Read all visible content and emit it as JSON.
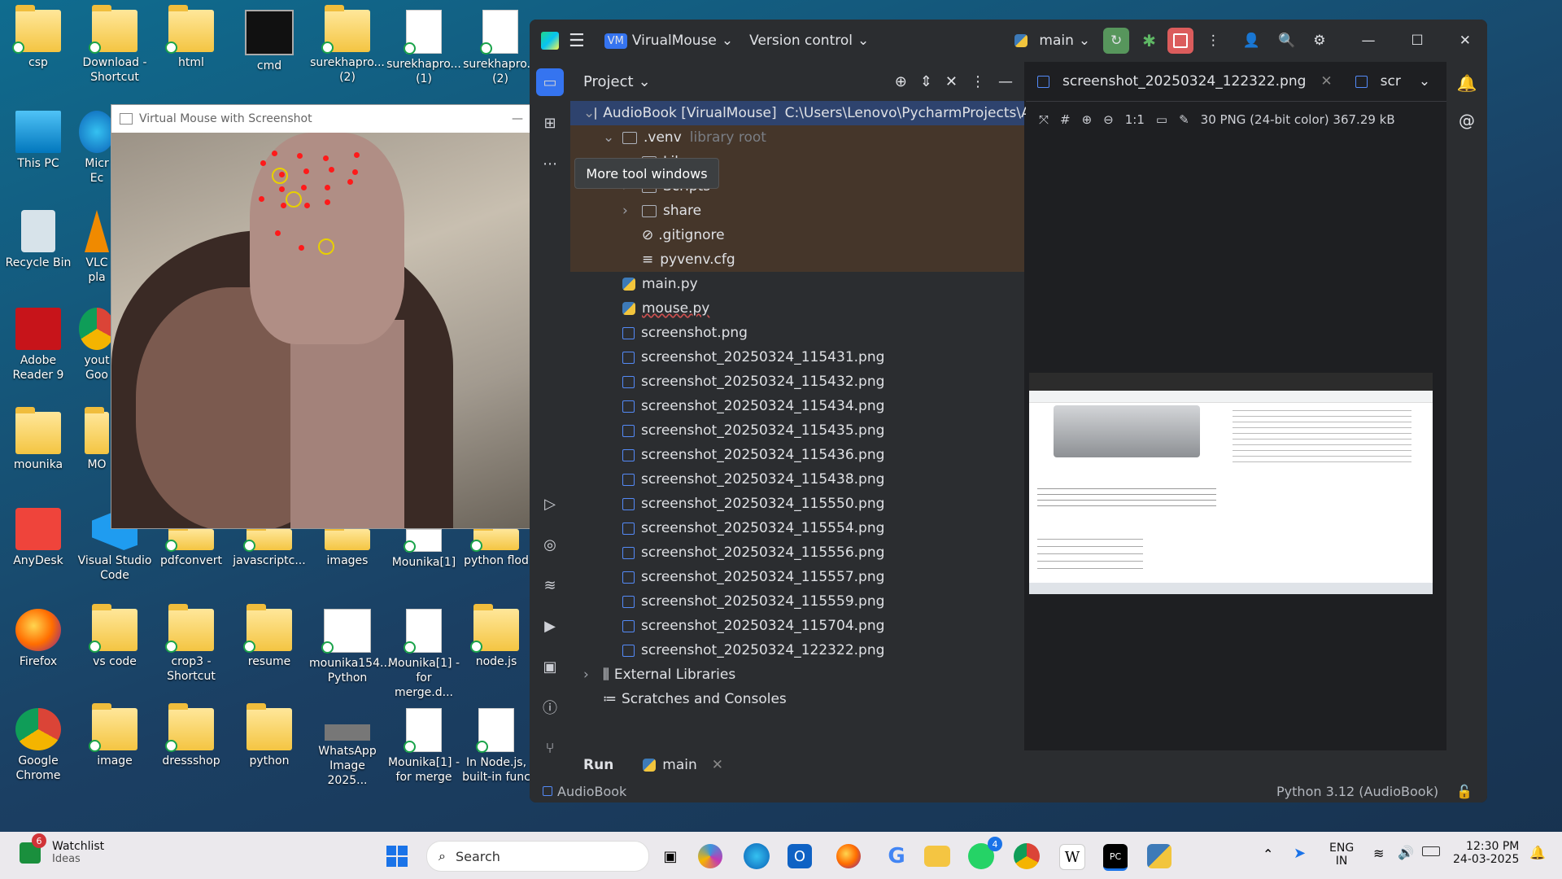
{
  "desktop": {
    "icons": [
      {
        "label": "csp"
      },
      {
        "label": "Download - Shortcut"
      },
      {
        "label": "html"
      },
      {
        "label": "cmd"
      },
      {
        "label": "surekhapro... (2)"
      },
      {
        "label": "surekhapro... (1)"
      },
      {
        "label": "surekhapro... (2)"
      },
      {
        "label": "This PC"
      },
      {
        "label": "Micr Ec"
      },
      {
        "label": "Recycle Bin"
      },
      {
        "label": "VLC pla"
      },
      {
        "label": "Adobe Reader 9"
      },
      {
        "label": "yout Goo"
      },
      {
        "label": "mounika"
      },
      {
        "label": "MO"
      },
      {
        "label": "AnyDesk"
      },
      {
        "label": "Visual Studio Code"
      },
      {
        "label": "pdfconvert"
      },
      {
        "label": "javascriptc..."
      },
      {
        "label": "images"
      },
      {
        "label": "Mounika[1]"
      },
      {
        "label": "python flod"
      },
      {
        "label": "Firefox"
      },
      {
        "label": "vs code"
      },
      {
        "label": "crop3 - Shortcut"
      },
      {
        "label": "resume"
      },
      {
        "label": "mounika154... Python"
      },
      {
        "label": "Mounika[1] - for merge.d..."
      },
      {
        "label": "node.js"
      },
      {
        "label": "Google Chrome"
      },
      {
        "label": "image"
      },
      {
        "label": "dressshop"
      },
      {
        "label": "python"
      },
      {
        "label": "WhatsApp Image 2025..."
      },
      {
        "label": "Mounika[1] - for merge"
      },
      {
        "label": "In Node.js, built-in func"
      }
    ]
  },
  "cam_window": {
    "title": "Virtual Mouse with Screenshot"
  },
  "ide": {
    "project_badge": "VM",
    "project_name": "VirualMouse",
    "version_control": "Version control",
    "branch": "main",
    "panel_title": "Project",
    "tooltip": "More tool windows",
    "tree": [
      {
        "name": "AudioBook [VirualMouse]",
        "extra": "C:\\Users\\Lenovo\\PycharmProjects\\Au",
        "type": "folder"
      },
      {
        "name": ".venv",
        "extra": "library root",
        "type": "folder"
      },
      {
        "name": "Lib",
        "extra": "",
        "type": "folder"
      },
      {
        "name": "Scripts",
        "extra": "",
        "type": "folder"
      },
      {
        "name": "share",
        "extra": "",
        "type": "folder"
      },
      {
        "name": ".gitignore",
        "extra": "",
        "type": "ignore"
      },
      {
        "name": "pyvenv.cfg",
        "extra": "",
        "type": "cfg"
      },
      {
        "name": "main.py",
        "extra": "",
        "type": "py"
      },
      {
        "name": "mouse.py",
        "extra": "",
        "type": "py"
      },
      {
        "name": "screenshot.png",
        "extra": "",
        "type": "png"
      },
      {
        "name": "screenshot_20250324_115431.png",
        "extra": "",
        "type": "png"
      },
      {
        "name": "screenshot_20250324_115432.png",
        "extra": "",
        "type": "png"
      },
      {
        "name": "screenshot_20250324_115434.png",
        "extra": "",
        "type": "png"
      },
      {
        "name": "screenshot_20250324_115435.png",
        "extra": "",
        "type": "png"
      },
      {
        "name": "screenshot_20250324_115436.png",
        "extra": "",
        "type": "png"
      },
      {
        "name": "screenshot_20250324_115438.png",
        "extra": "",
        "type": "png"
      },
      {
        "name": "screenshot_20250324_115550.png",
        "extra": "",
        "type": "png"
      },
      {
        "name": "screenshot_20250324_115554.png",
        "extra": "",
        "type": "png"
      },
      {
        "name": "screenshot_20250324_115556.png",
        "extra": "",
        "type": "png"
      },
      {
        "name": "screenshot_20250324_115557.png",
        "extra": "",
        "type": "png"
      },
      {
        "name": "screenshot_20250324_115559.png",
        "extra": "",
        "type": "png"
      },
      {
        "name": "screenshot_20250324_115704.png",
        "extra": "",
        "type": "png"
      },
      {
        "name": "screenshot_20250324_122322.png",
        "extra": "",
        "type": "png"
      },
      {
        "name": "External Libraries",
        "extra": "",
        "type": "lib"
      },
      {
        "name": "Scratches and Consoles",
        "extra": "",
        "type": "scratch"
      }
    ],
    "tabs": [
      {
        "label": "screenshot_20250324_122322.png"
      },
      {
        "label": "scr"
      }
    ],
    "image_tools": {
      "zoom_label": "1:1",
      "info": "30 PNG (24-bit color) 367.29 kB"
    },
    "run": {
      "label": "Run",
      "config": "main"
    },
    "status": {
      "project": "AudioBook",
      "interpreter": "Python 3.12 (AudioBook)"
    }
  },
  "taskbar": {
    "widget_title": "Watchlist",
    "widget_sub": "Ideas",
    "widget_badge": "6",
    "search_placeholder": "Search",
    "whatsapp_badge": "4",
    "lang_top": "ENG",
    "lang_bottom": "IN",
    "time": "12:30 PM",
    "date": "24-03-2025"
  }
}
